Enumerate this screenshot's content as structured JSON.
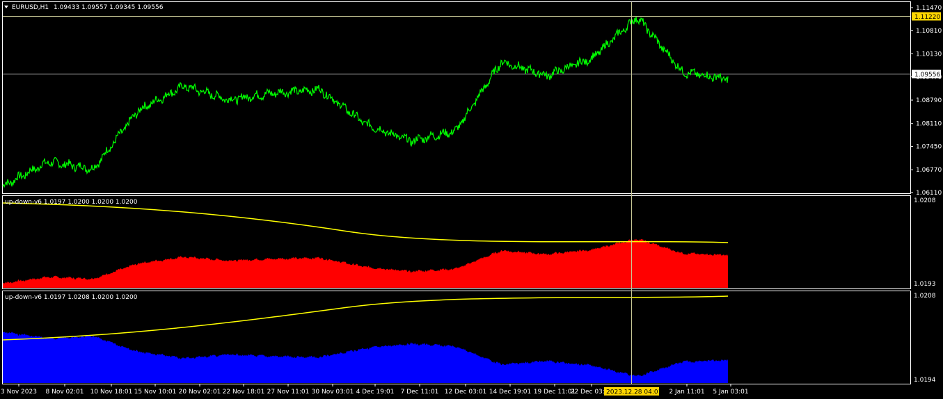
{
  "main_panel": {
    "header": {
      "symbol_timeframe": "EURUSD,H1",
      "ohlc": "1.09433 1.09557 1.09345 1.09556"
    },
    "price_ticks": [
      "1.11470",
      "1.10810",
      "1.10130",
      "1.09470",
      "1.08790",
      "1.08110",
      "1.07450",
      "1.06770",
      "1.06110"
    ],
    "price_range": [
      1.0611,
      1.1147
    ],
    "horizontal_lines": [
      {
        "price": 1.1122,
        "label": "1.11220",
        "color": "#c8c896"
      },
      {
        "price": 1.09556,
        "label": "1.09556",
        "color": "#c0c0c0"
      }
    ],
    "series_color": "#00ff00"
  },
  "indicator_1": {
    "header": "up-down-v6 1.0197 1.0200 1.0200 1.0200",
    "scale_top": "1.0208",
    "scale_bottom": "1.0193",
    "fill_color": "#ff0000",
    "line_color": "#ffff00"
  },
  "indicator_2": {
    "header": "up-down-v6 1.0197 1.0208 1.0200 1.0200",
    "scale_top": "1.0208",
    "scale_bottom": "1.0194",
    "fill_color": "#0000ff",
    "line_color": "#ffff00"
  },
  "time_axis": {
    "labels": [
      "3 Nov 2023",
      "8 Nov 02:01",
      "10 Nov 18:01",
      "15 Nov 10:01",
      "20 Nov 02:01",
      "22 Nov 18:01",
      "27 Nov 11:01",
      "30 Nov 03:01",
      "4 Dec 19:01",
      "7 Dec 11:01",
      "12 Dec 03:01",
      "14 Dec 19:01",
      "19 Dec 11:01",
      "22 Dec 03:01",
      "2 Jan 11:01",
      "5 Jan 03:01"
    ],
    "crosshair_time": "2023.12.28 04:01"
  },
  "chart_data": {
    "type": "line",
    "title": "EURUSD,H1",
    "series": [
      {
        "name": "EURUSD",
        "x": [
          "3 Nov 2023",
          "8 Nov 02:01",
          "10 Nov 18:01",
          "15 Nov 10:01",
          "20 Nov 02:01",
          "22 Nov 18:01",
          "27 Nov 11:01",
          "30 Nov 03:01",
          "4 Dec 19:01",
          "7 Dec 11:01",
          "12 Dec 03:01",
          "14 Dec 19:01",
          "19 Dec 11:01",
          "22 Dec 03:01",
          "28 Dec 04:01",
          "2 Jan 11:01",
          "5 Jan 03:01"
        ],
        "values": [
          1.063,
          1.07,
          1.068,
          1.085,
          1.092,
          1.088,
          1.09,
          1.091,
          1.081,
          1.076,
          1.079,
          1.099,
          1.095,
          1.1,
          1.112,
          1.096,
          1.094
        ]
      }
    ],
    "ylim": [
      1.0611,
      1.1147
    ]
  }
}
